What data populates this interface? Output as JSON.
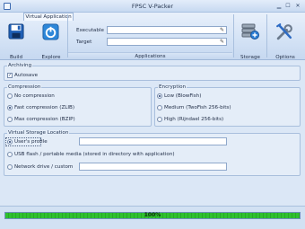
{
  "window": {
    "title": "FPSC V-Packer"
  },
  "ribbon": {
    "tab_label": "Virtual Application",
    "build_label": "Build",
    "explore_label": "Explore",
    "executable_label": "Executable",
    "executable_value": "",
    "target_label": "Target",
    "target_value": "",
    "applications_group": "Applications",
    "storage_label": "Storage",
    "options_label": "Options"
  },
  "archiving": {
    "title": "Archiving",
    "autosave_label": "Autosave",
    "autosave_checked": true
  },
  "compression": {
    "title": "Compression",
    "options": [
      {
        "label": "No compression",
        "selected": false
      },
      {
        "label": "Fast compression (ZLIB)",
        "selected": true
      },
      {
        "label": "Max compression (BZIP)",
        "selected": false
      }
    ]
  },
  "encryption": {
    "title": "Encryption",
    "options": [
      {
        "label": "Low (BlowFish)",
        "selected": true
      },
      {
        "label": "Medium (TwoFish 256-bits)",
        "selected": false
      },
      {
        "label": "High (Rijndael 256-bits)",
        "selected": false
      }
    ]
  },
  "storage": {
    "title": "Virtual Storage Location",
    "options": [
      {
        "label": "User's profile",
        "selected": true,
        "value": ""
      },
      {
        "label": "USB flash / portable media (stored in directory with application)",
        "selected": false
      },
      {
        "label": "Network drive / custom",
        "selected": false,
        "value": ""
      }
    ]
  },
  "progress": {
    "text": "100%",
    "percent": 100
  },
  "colors": {
    "accent": "#2d6bc4",
    "progress": "#2fc12f"
  }
}
